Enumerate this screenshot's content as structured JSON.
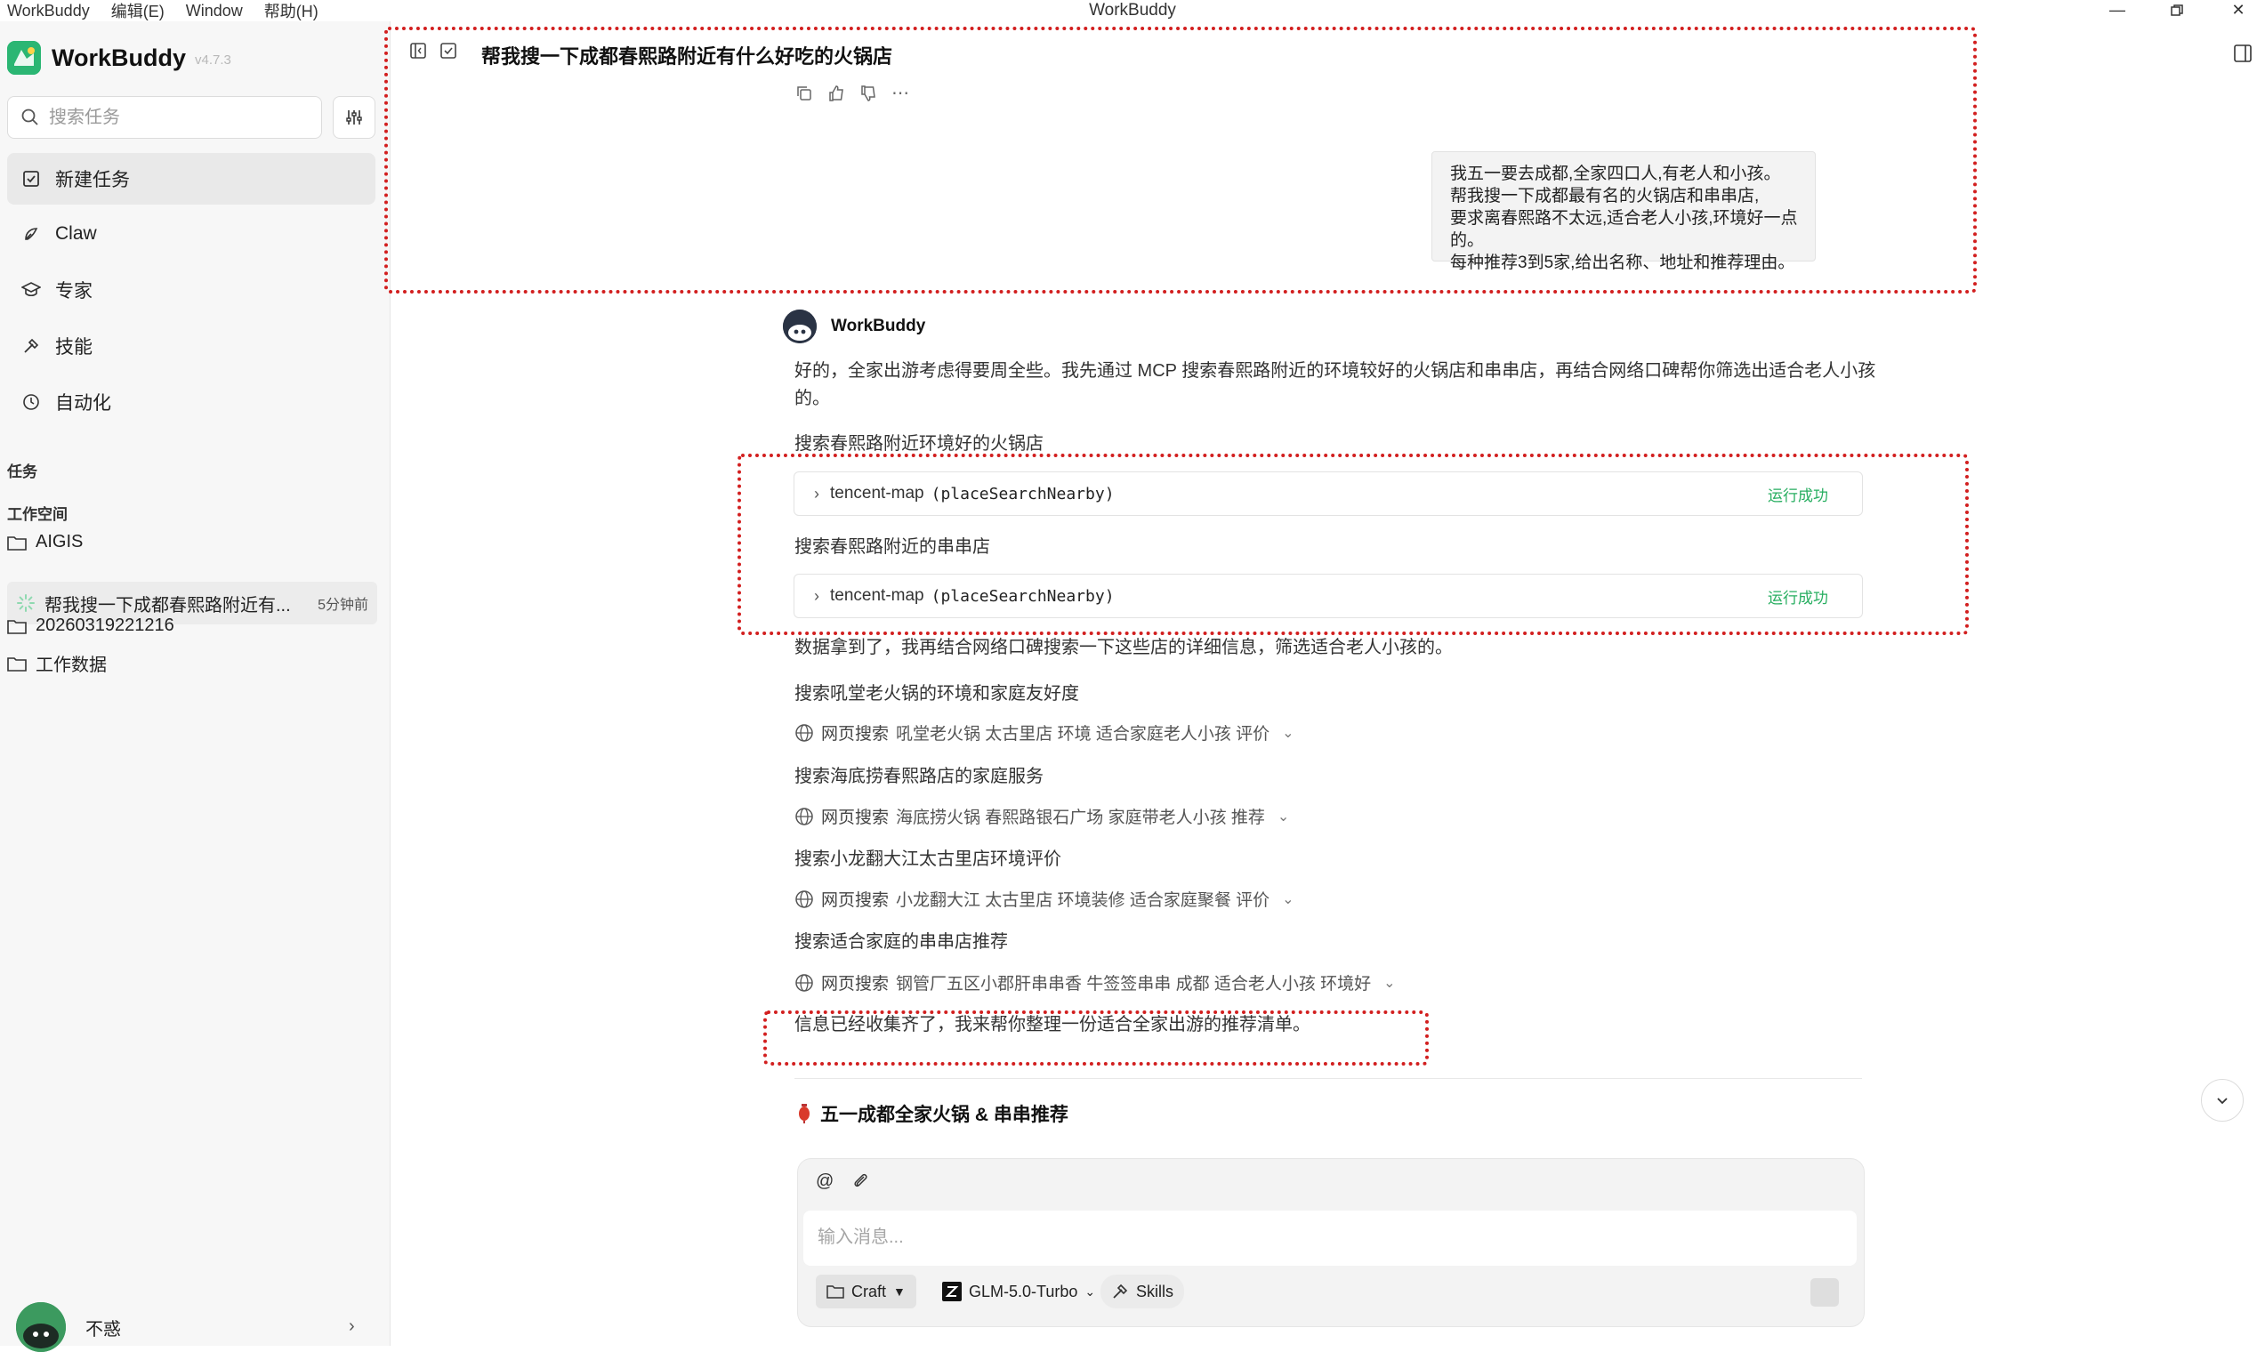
{
  "titlebar": {
    "menu": [
      "WorkBuddy",
      "编辑(E)",
      "Window",
      "帮助(H)"
    ],
    "title": "WorkBuddy"
  },
  "sidebar": {
    "brand": "WorkBuddy",
    "version": "v4.7.3",
    "search_placeholder": "搜索任务",
    "nav": [
      "新建任务",
      "Claw",
      "专家",
      "技能",
      "自动化"
    ],
    "tasks_label": "任务",
    "workspace_label": "工作空间",
    "workspace_folder": "AIGIS",
    "current_task": "帮我搜一下成都春熙路附近有...",
    "current_task_time": "5分钟前",
    "folders": [
      "20260319221216",
      "工作数据"
    ],
    "user_name": "不惑"
  },
  "chat": {
    "title": "帮我搜一下成都春熙路附近有什么好吃的火锅店",
    "user_message": [
      "我五一要去成都,全家四口人,有老人和小孩。",
      "帮我搜一下成都最有名的火锅店和串串店,",
      "要求离春熙路不太远,适合老人小孩,环境好一点的。",
      "每种推荐3到5家,给出名称、地址和推荐理由。"
    ],
    "bot_name": "WorkBuddy",
    "intro": [
      "好的，全家出游考虑得要周全些。我先通过 MCP 搜索春熙路附近的环境较好的火锅店和串串店，再结合网络口碑帮你筛选出适合老人小孩",
      "的。"
    ],
    "step1": "搜索春熙路附近环境好的火锅店",
    "tool1": {
      "name": "tencent-map",
      "fn": "(placeSearchNearby)",
      "status": "运行成功"
    },
    "step2": "搜索春熙路附近的串串店",
    "tool2": {
      "name": "tencent-map",
      "fn": "(placeSearchNearby)",
      "status": "运行成功"
    },
    "after_tools": "数据拿到了，我再结合网络口碑搜索一下这些店的详细信息，筛选适合老人小孩的。",
    "searches": [
      {
        "title": "搜索吼堂老火锅的环境和家庭友好度",
        "label": "网页搜索",
        "query": "吼堂老火锅 太古里店 环境 适合家庭老人小孩 评价"
      },
      {
        "title": "搜索海底捞春熙路店的家庭服务",
        "label": "网页搜索",
        "query": "海底捞火锅 春熙路银石广场 家庭带老人小孩 推荐"
      },
      {
        "title": "搜索小龙翻大江太古里店环境评价",
        "label": "网页搜索",
        "query": "小龙翻大江 太古里店 环境装修 适合家庭聚餐 评价"
      },
      {
        "title": "搜索适合家庭的串串店推荐",
        "label": "网页搜索",
        "query": "钢管厂五区小郡肝串串香 牛签签串串 成都 适合老人小孩 环境好"
      }
    ],
    "summary": "信息已经收集齐了，我来帮你整理一份适合全家出游的推荐清单。",
    "rec_title": "五一成都全家火锅 & 串串推荐"
  },
  "composer": {
    "placeholder": "输入消息...",
    "mode": "Craft",
    "model": "GLM-5.0-Turbo",
    "skills": "Skills"
  },
  "colors": {
    "success": "#27ae60",
    "brand": "#2bb673",
    "annotation": "#d21f1f"
  }
}
